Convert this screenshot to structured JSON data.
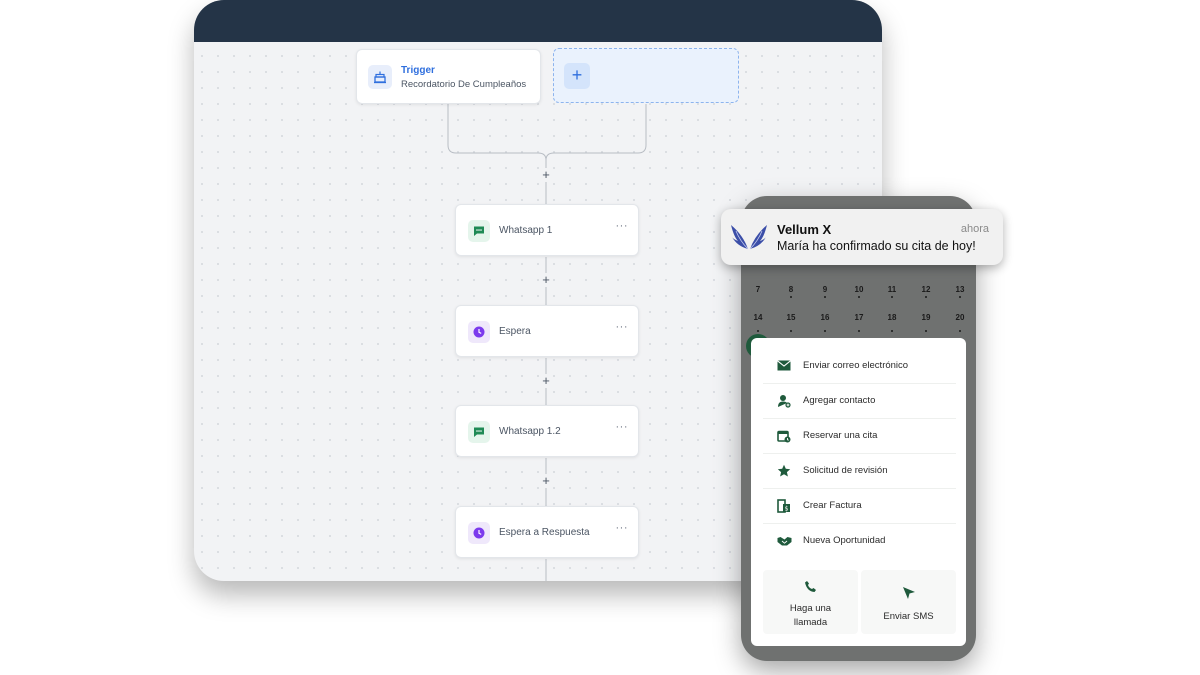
{
  "workflow": {
    "trigger": {
      "title": "Trigger",
      "subtitle": "Recordatorio De Cumpleaños",
      "icon": "cake-icon"
    },
    "add_trigger": {
      "label": "+"
    },
    "connector_plus": "+",
    "steps": [
      {
        "label": "Whatsapp 1",
        "icon": "chat-icon",
        "menu": "···"
      },
      {
        "label": "Espera",
        "icon": "clock-icon",
        "menu": "···"
      },
      {
        "label": "Whatsapp 1.2",
        "icon": "chat-icon",
        "menu": "···"
      },
      {
        "label": "Espera a Respuesta",
        "icon": "clock-icon",
        "menu": "···"
      }
    ]
  },
  "calendar": {
    "rows": [
      [
        "7",
        "8",
        "9",
        "10",
        "11",
        "12",
        "13"
      ],
      [
        "14",
        "15",
        "16",
        "17",
        "18",
        "19",
        "20"
      ]
    ]
  },
  "notification": {
    "app": "Vellum X",
    "time": "ahora",
    "message": "María ha confirmado su cita de hoy!",
    "icon": "wings-logo-icon"
  },
  "actions": {
    "items": [
      {
        "label": "Enviar correo electrónico",
        "icon": "mail-icon"
      },
      {
        "label": "Agregar contacto",
        "icon": "add-contact-icon"
      },
      {
        "label": "Reservar una cita",
        "icon": "calendar-icon"
      },
      {
        "label": "Solicitud de revisión",
        "icon": "star-icon"
      },
      {
        "label": "Crear Factura",
        "icon": "invoice-icon"
      },
      {
        "label": "Nueva Oportunidad",
        "icon": "handshake-icon"
      }
    ],
    "call": {
      "line1": "Haga una",
      "line2": "llamada",
      "icon": "phone-icon"
    },
    "sms": {
      "label": "Enviar SMS",
      "icon": "send-icon"
    }
  },
  "colors": {
    "header": "#243447",
    "accent_blue": "#2f6fde",
    "whatsapp_green": "#1f8a55",
    "wait_purple": "#7c3aed",
    "action_green": "#1f5a3c"
  }
}
